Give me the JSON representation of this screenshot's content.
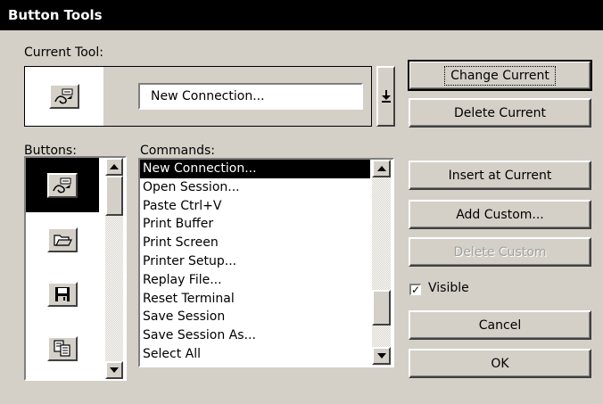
{
  "window": {
    "title": "Button Tools"
  },
  "current_tool": {
    "label": "Current Tool:",
    "value": "New Connection...",
    "dropdown_icon": "down-arrow-icon"
  },
  "buttons_panel": {
    "label": "Buttons:",
    "items": [
      {
        "icon": "connection-icon",
        "selected": true
      },
      {
        "icon": "open-folder-icon",
        "selected": false
      },
      {
        "icon": "save-disk-icon",
        "selected": false
      },
      {
        "icon": "copy-icon",
        "selected": false
      }
    ]
  },
  "commands_panel": {
    "label": "Commands:",
    "items": [
      "New Connection...",
      "Open Session...",
      "Paste  Ctrl+V",
      "Print Buffer",
      "Print Screen",
      "Printer Setup...",
      "Replay File...",
      "Reset Terminal",
      "Save Session",
      "Save Session As...",
      "Select All"
    ],
    "selected_index": 0
  },
  "actions": {
    "change_current": "Change Current",
    "delete_current": "Delete Current",
    "insert_at_current": "Insert at Current",
    "add_custom": "Add Custom...",
    "delete_custom": "Delete Custom",
    "visible_label": "Visible",
    "visible_checked": true,
    "cancel": "Cancel",
    "ok": "OK"
  }
}
